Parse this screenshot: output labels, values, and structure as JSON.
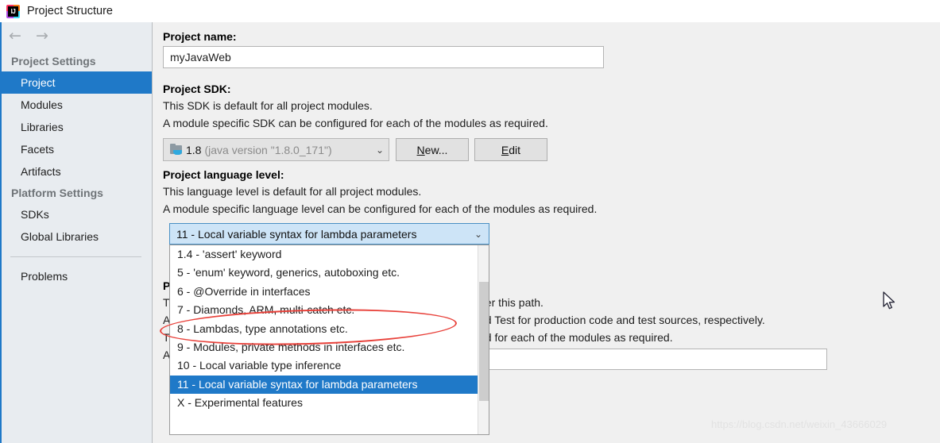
{
  "window": {
    "title": "Project Structure",
    "app_icon": "intellij-idea-icon",
    "logo_text": "IJ"
  },
  "nav": {
    "back_icon": "arrow-left-icon",
    "forward_icon": "arrow-right-icon",
    "back_glyph": "←",
    "forward_glyph": "→"
  },
  "sidebar": {
    "groups": [
      {
        "header": "Project Settings",
        "items": [
          {
            "label": "Project",
            "selected": true
          },
          {
            "label": "Modules",
            "selected": false
          },
          {
            "label": "Libraries",
            "selected": false
          },
          {
            "label": "Facets",
            "selected": false
          },
          {
            "label": "Artifacts",
            "selected": false
          }
        ]
      },
      {
        "header": "Platform Settings",
        "items": [
          {
            "label": "SDKs",
            "selected": false
          },
          {
            "label": "Global Libraries",
            "selected": false
          }
        ]
      }
    ],
    "problems": {
      "label": "Problems",
      "selected": false
    }
  },
  "main": {
    "project_name": {
      "label": "Project name:",
      "value": "myJavaWeb"
    },
    "project_sdk": {
      "label": "Project SDK:",
      "desc_line1": "This SDK is default for all project modules.",
      "desc_line2": "A module specific SDK can be configured for each of the modules as required.",
      "selected_version": "1.8",
      "selected_detail": "(java version \"1.8.0_171\")",
      "sdk_icon": "java-sdk-folder-icon",
      "caret_icon": "chevron-down-icon",
      "caret_glyph": "⌄",
      "new_button": {
        "mnemonic": "N",
        "rest": "ew..."
      },
      "edit_button": {
        "mnemonic": "E",
        "rest": "dit"
      }
    },
    "language_level": {
      "label": "Project language level:",
      "desc_line1": "This language level is default for all project modules.",
      "desc_line2": "A module specific language level can be configured for each of the modules as required.",
      "selected_value": "11 - Local variable syntax for lambda parameters",
      "caret_icon": "chevron-down-icon",
      "caret_glyph": "⌄",
      "options": [
        {
          "label": "1.4 - 'assert' keyword",
          "selected": false
        },
        {
          "label": "5 - 'enum' keyword, generics, autoboxing etc.",
          "selected": false
        },
        {
          "label": "6 - @Override in interfaces",
          "selected": false
        },
        {
          "label": "7 - Diamonds, ARM, multi-catch etc.",
          "selected": false
        },
        {
          "label": "8 - Lambdas, type annotations etc.",
          "selected": false
        },
        {
          "label": "9 - Modules, private methods in interfaces etc.",
          "selected": false
        },
        {
          "label": "10 - Local variable type inference",
          "selected": false
        },
        {
          "label": "11 - Local variable syntax for lambda parameters",
          "selected": true
        },
        {
          "label": "X - Experimental features",
          "selected": false
        }
      ]
    },
    "compiler_output": {
      "label_fragment": "P",
      "desc_frag_1": "T",
      "desc_frag_2": "A",
      "desc_frag_3": "T",
      "desc_frag_4": "A",
      "visible_line1": "der this path.",
      "visible_line2": "nd Test for production code and test sources, respectively.",
      "visible_line3": "ed for each of the modules as required.",
      "path_value": "",
      "browse_icon": "folder-browse-icon"
    }
  },
  "annotation": {
    "ellipse_icon": "red-ellipse-highlight",
    "ellipse_color": "#e8413a",
    "highlights_option": "8 - Lambdas, type annotations etc."
  },
  "cursor": {
    "icon": "mouse-pointer-icon"
  },
  "watermark": {
    "text": "https://blog.csdn.net/weixin_43666029"
  },
  "colors": {
    "accent_blue": "#1f79c8",
    "sidebar_bg": "#e8ecf0",
    "panel_bg": "#f0f0f0",
    "combo_open_bg": "#cde4f7",
    "annotation_red": "#e8413a"
  }
}
